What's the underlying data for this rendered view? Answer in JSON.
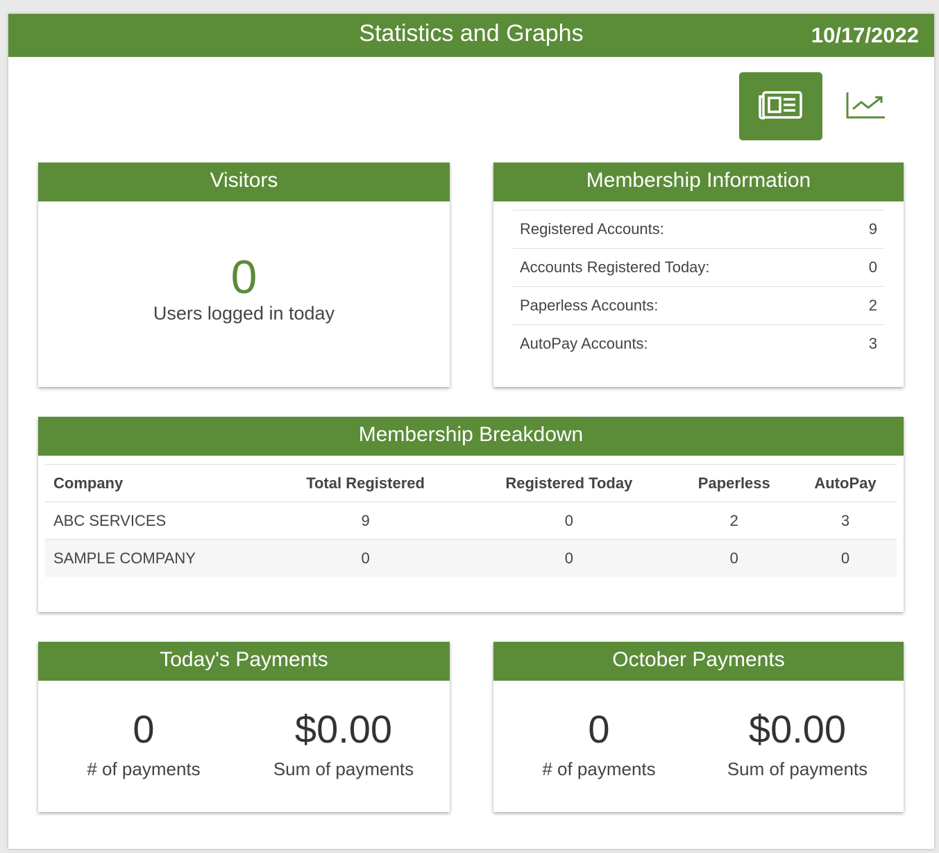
{
  "header": {
    "title": "Statistics and Graphs",
    "date": "10/17/2022"
  },
  "view_toggle": {
    "table_icon": "newspaper-icon",
    "graph_icon": "line-chart-icon",
    "active": "table"
  },
  "colors": {
    "accent": "#5b8c38"
  },
  "visitors": {
    "title": "Visitors",
    "count": "0",
    "label": "Users logged in today"
  },
  "membership_info": {
    "title": "Membership Information",
    "rows": [
      {
        "label": "Registered Accounts:",
        "value": "9"
      },
      {
        "label": "Accounts Registered Today:",
        "value": "0"
      },
      {
        "label": "Paperless Accounts:",
        "value": "2"
      },
      {
        "label": "AutoPay Accounts:",
        "value": "3"
      }
    ]
  },
  "breakdown": {
    "title": "Membership Breakdown",
    "columns": [
      "Company",
      "Total Registered",
      "Registered Today",
      "Paperless",
      "AutoPay"
    ],
    "rows": [
      [
        "ABC SERVICES",
        "9",
        "0",
        "2",
        "3"
      ],
      [
        "SAMPLE COMPANY",
        "0",
        "0",
        "0",
        "0"
      ]
    ]
  },
  "todays_payments": {
    "title": "Today's Payments",
    "count": "0",
    "count_label": "# of payments",
    "sum": "$0.00",
    "sum_label": "Sum of payments"
  },
  "month_payments": {
    "title": "October Payments",
    "count": "0",
    "count_label": "# of payments",
    "sum": "$0.00",
    "sum_label": "Sum of payments"
  }
}
